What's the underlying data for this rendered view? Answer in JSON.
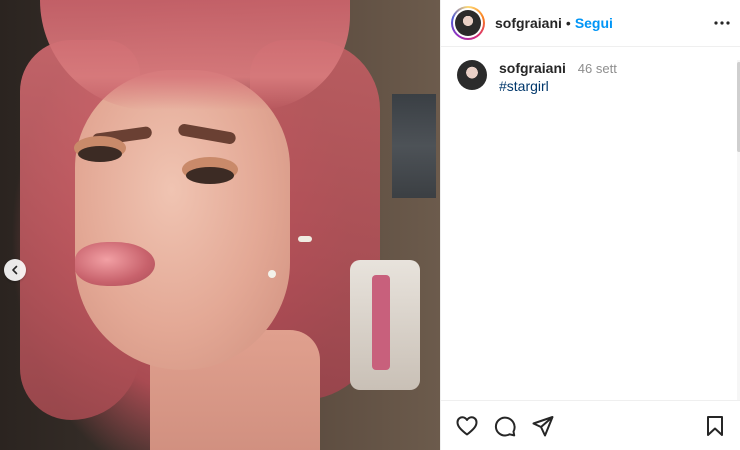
{
  "post": {
    "username": "sofgraiani",
    "separator": "•",
    "follow_label": "Segui",
    "more_label": "•••",
    "caption": {
      "username": "sofgraiani",
      "time": "46 sett",
      "hashtag": "#stargirl"
    }
  },
  "carousel": {
    "prev_icon": "chevron-left-icon"
  },
  "actions": [
    {
      "name": "like",
      "icon": "heart-icon"
    },
    {
      "name": "comment",
      "icon": "comment-bubble-icon"
    },
    {
      "name": "share",
      "icon": "paper-plane-icon"
    },
    {
      "name": "save",
      "icon": "bookmark-icon"
    }
  ],
  "colors": {
    "follow": "#0095f6",
    "hashtag": "#00376b",
    "text": "#262626",
    "muted": "#8e8e8e"
  }
}
